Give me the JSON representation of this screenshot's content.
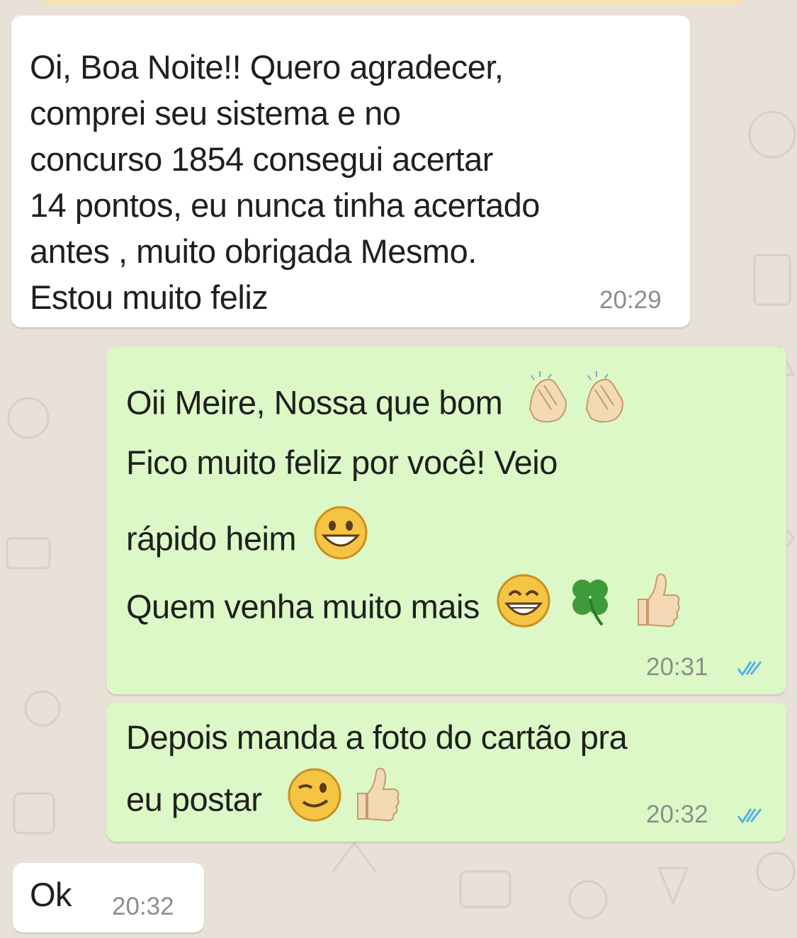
{
  "messages": [
    {
      "direction": "incoming",
      "lines": [
        "Oi, Boa Noite!! Quero agradecer,",
        "comprei seu sistema e no",
        "concurso 1854 consegui acertar",
        "14 pontos, eu nunca tinha acertado",
        "antes , muito obrigada Mesmo.",
        "Estou muito feliz"
      ],
      "time": "20:29"
    },
    {
      "direction": "outgoing",
      "lines": [
        "Oii Meire, Nossa que bom",
        "Fico muito feliz por você! Veio",
        "rápido heim",
        "Quem venha muito mais"
      ],
      "time": "20:31",
      "status": "read"
    },
    {
      "direction": "outgoing",
      "lines": [
        "Depois manda a foto do cartão pra",
        "eu postar"
      ],
      "time": "20:32",
      "status": "read"
    },
    {
      "direction": "incoming",
      "lines": [
        "Ok"
      ],
      "time": "20:32"
    }
  ],
  "emoji": {
    "clap": "clapping-hands",
    "grin": "grinning-face",
    "smile": "beaming-face",
    "clover": "four-leaf-clover",
    "thumbs": "thumbs-up",
    "wink": "winking-face"
  },
  "colors": {
    "incoming_bubble": "#ffffff",
    "outgoing_bubble": "#dcf8c6",
    "chat_background": "#e7e1d7",
    "read_ticks": "#4fb3e6",
    "timestamp": "#8b8f8a"
  }
}
